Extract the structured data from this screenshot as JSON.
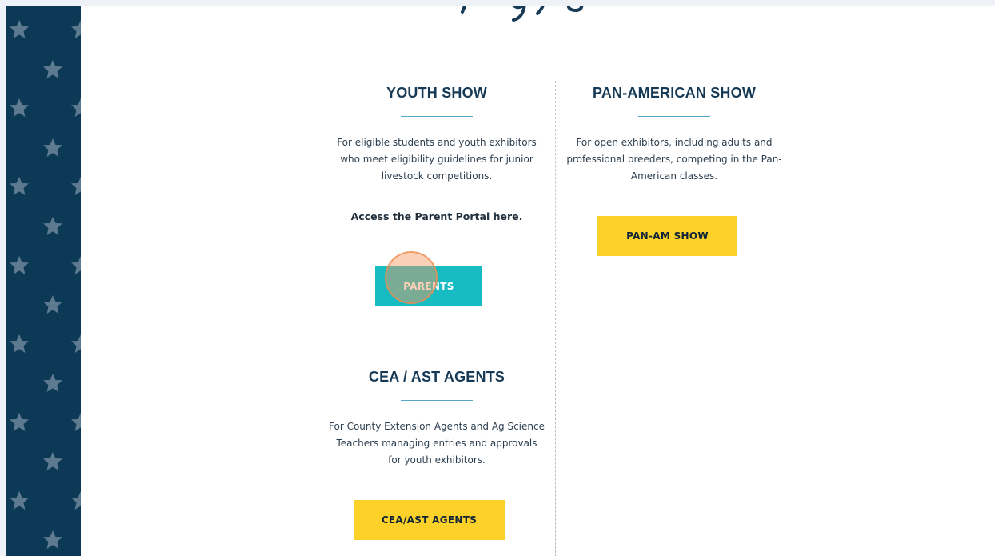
{
  "youth": {
    "title": "YOUTH SHOW",
    "description": "For eligible students and youth exhibitors who meet eligibility guidelines for junior livestock competitions.",
    "portal_text": "Access the Parent Portal here.",
    "button_label": "PARENTS"
  },
  "pan_american": {
    "title": "PAN-AMERICAN SHOW",
    "description": "For open exhibitors, including adults and professional breeders, competing in the Pan-American classes.",
    "button_label": "PAN-AM SHOW"
  },
  "cea": {
    "title": "CEA / AST AGENTS",
    "description": "For County Extension Agents and Ag Science Teachers managing entries and approvals for youth exhibitors.",
    "button_label": "CEA/AST AGENTS"
  },
  "colors": {
    "navy": "#0c3a56",
    "yellow": "#fcd12a",
    "teal": "#17bcc2",
    "accent_rule": "#57a6c8"
  },
  "icons": {
    "star_pattern": "star-icon"
  }
}
